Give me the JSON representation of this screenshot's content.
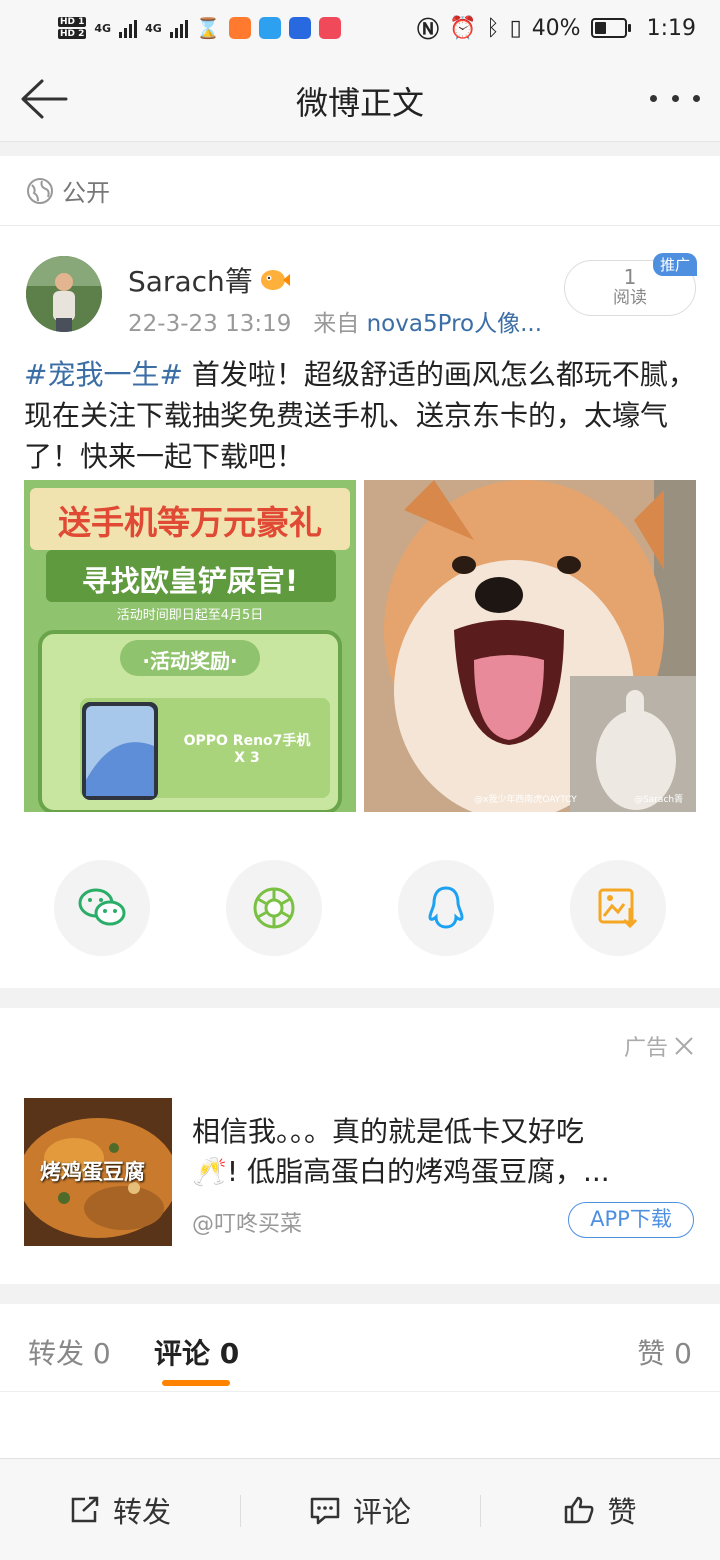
{
  "status_bar": {
    "hd1": "HD 1",
    "hd2": "HD 2",
    "net1": "4G",
    "net2": "4G",
    "battery_text": "40%",
    "battery_level": 0.4,
    "time": "1:19"
  },
  "nav": {
    "title": "微博正文"
  },
  "visibility": {
    "label": "公开"
  },
  "post": {
    "author": "Sarach箐",
    "time": "22-3-23 13:19",
    "source_prefix": "来自",
    "source": "nova5Pro人像...",
    "read_count": "1",
    "read_label": "阅读",
    "promo_badge": "推广",
    "hashtag": "#宠我一生#",
    "text": " 首发啦！超级舒适的画风怎么都玩不腻，现在关注下载抽奖免费送手机、送京东卡的，太壕气了！快来一起下载吧！",
    "image1": {
      "line1": "送手机等万元豪礼",
      "line2": "寻找欧皇铲屎官!",
      "line3": "活动时间即日起至4月5日",
      "line4": "·活动奖励·",
      "line5": "OPPO Reno7手机",
      "line6": "X 3"
    },
    "image2": {
      "watermark1": "@x我少年西南虎OAYTCY",
      "watermark2": "@Sarach箐"
    }
  },
  "share_buttons": [
    {
      "icon": "wechat-icon",
      "color": "#2aae67"
    },
    {
      "icon": "moments-icon",
      "color": "#7ac143"
    },
    {
      "icon": "qq-icon",
      "color": "#1da1f2"
    },
    {
      "icon": "save-image-icon",
      "color": "#f5a623"
    }
  ],
  "ad": {
    "label": "广告",
    "line1": "相信我。。。真的就是低卡又好吃",
    "line2": "🥂! 低脂高蛋白的烤鸡蛋豆腐，...",
    "source": "@叮咚买菜",
    "button": "APP下载",
    "image_text": "烤鸡蛋豆腐"
  },
  "tabs": {
    "repost": "转发",
    "repost_count": "0",
    "comment": "评论",
    "comment_count": "0",
    "like": "赞",
    "like_count": "0"
  },
  "bottom_bar": {
    "repost": "转发",
    "comment": "评论",
    "like": "赞"
  },
  "colors": {
    "accent": "#ff8200",
    "link": "#3b6ea5",
    "button_blue": "#4e8fe0"
  }
}
